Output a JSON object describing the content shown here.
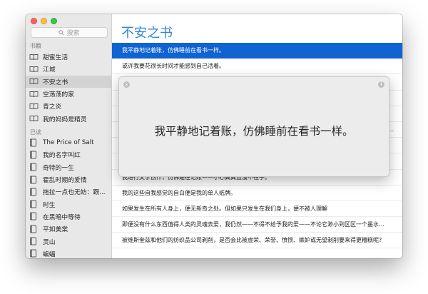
{
  "search": {
    "placeholder": "搜索"
  },
  "sidebar": {
    "section_books": "书籍",
    "books": [
      {
        "label": "甜蜜生活",
        "icon": "book-icon",
        "selected": false
      },
      {
        "label": "江城",
        "icon": "book-icon",
        "selected": false
      },
      {
        "label": "不安之书",
        "icon": "book-icon",
        "selected": true
      },
      {
        "label": "空荡荡的家",
        "icon": "book-icon",
        "selected": false
      },
      {
        "label": "青之炎",
        "icon": "book-icon",
        "selected": false
      },
      {
        "label": "我的妈妈是精灵",
        "icon": "book-icon",
        "selected": false
      }
    ],
    "section_read": "已读",
    "read": [
      {
        "label": "The Price of Salt",
        "icon": "closed-book-icon"
      },
      {
        "label": "我的名字叫红",
        "icon": "closed-book-icon"
      },
      {
        "label": "奇特的一生",
        "icon": "closed-book-icon"
      },
      {
        "label": "霍乱时期的爱情",
        "icon": "closed-book-icon"
      },
      {
        "label": "拖拉一点也无妨：跟...",
        "icon": "closed-book-icon"
      },
      {
        "label": "时生",
        "icon": "closed-book-icon"
      },
      {
        "label": "在黑暗中等待",
        "icon": "closed-book-icon"
      },
      {
        "label": "平如美棠",
        "icon": "closed-book-icon"
      },
      {
        "label": "灵山",
        "icon": "closed-book-icon"
      },
      {
        "label": "蝙蝠",
        "icon": "closed-book-icon"
      }
    ]
  },
  "main": {
    "title": "不安之书",
    "rows": [
      {
        "text": "我平静地记着账，仿佛睡前在看书一样。",
        "selected": true
      },
      {
        "text": "或许我要花很长时间才能感到自己活着。"
      },
      {
        "text": ""
      },
      {
        "text": ""
      },
      {
        "text": ""
      },
      {
        "text": "",
        "ellipsis": "..."
      },
      {
        "text": ""
      },
      {
        "text": ""
      },
      {
        "text": "我进行文学创作，仿佛是在记账——小心翼翼且漫不在乎。"
      },
      {
        "text": "我的这些自我感觉的自白便是我的单人纸牌。"
      },
      {
        "text": "如果发生在所有人身上，便无新奇之处。但如果只发生在我们身上，便不被人理解"
      },
      {
        "text": "即便没有什么东西值得人类的灵魂去爱，我仍然——不得不给予我的爱——不论它渺小到区区一个墨水..."
      },
      {
        "text": "被维斯奎兹和他们的纺织品公司剥削，是否会比被虚荣、荣誉、愤恨、嫉妒或无望剥削要来得更糟糕呢?"
      }
    ]
  },
  "popover": {
    "text": "我平静地记着账，仿佛睡前在看书一样。",
    "close_glyph": "×",
    "info_glyph": "i"
  }
}
